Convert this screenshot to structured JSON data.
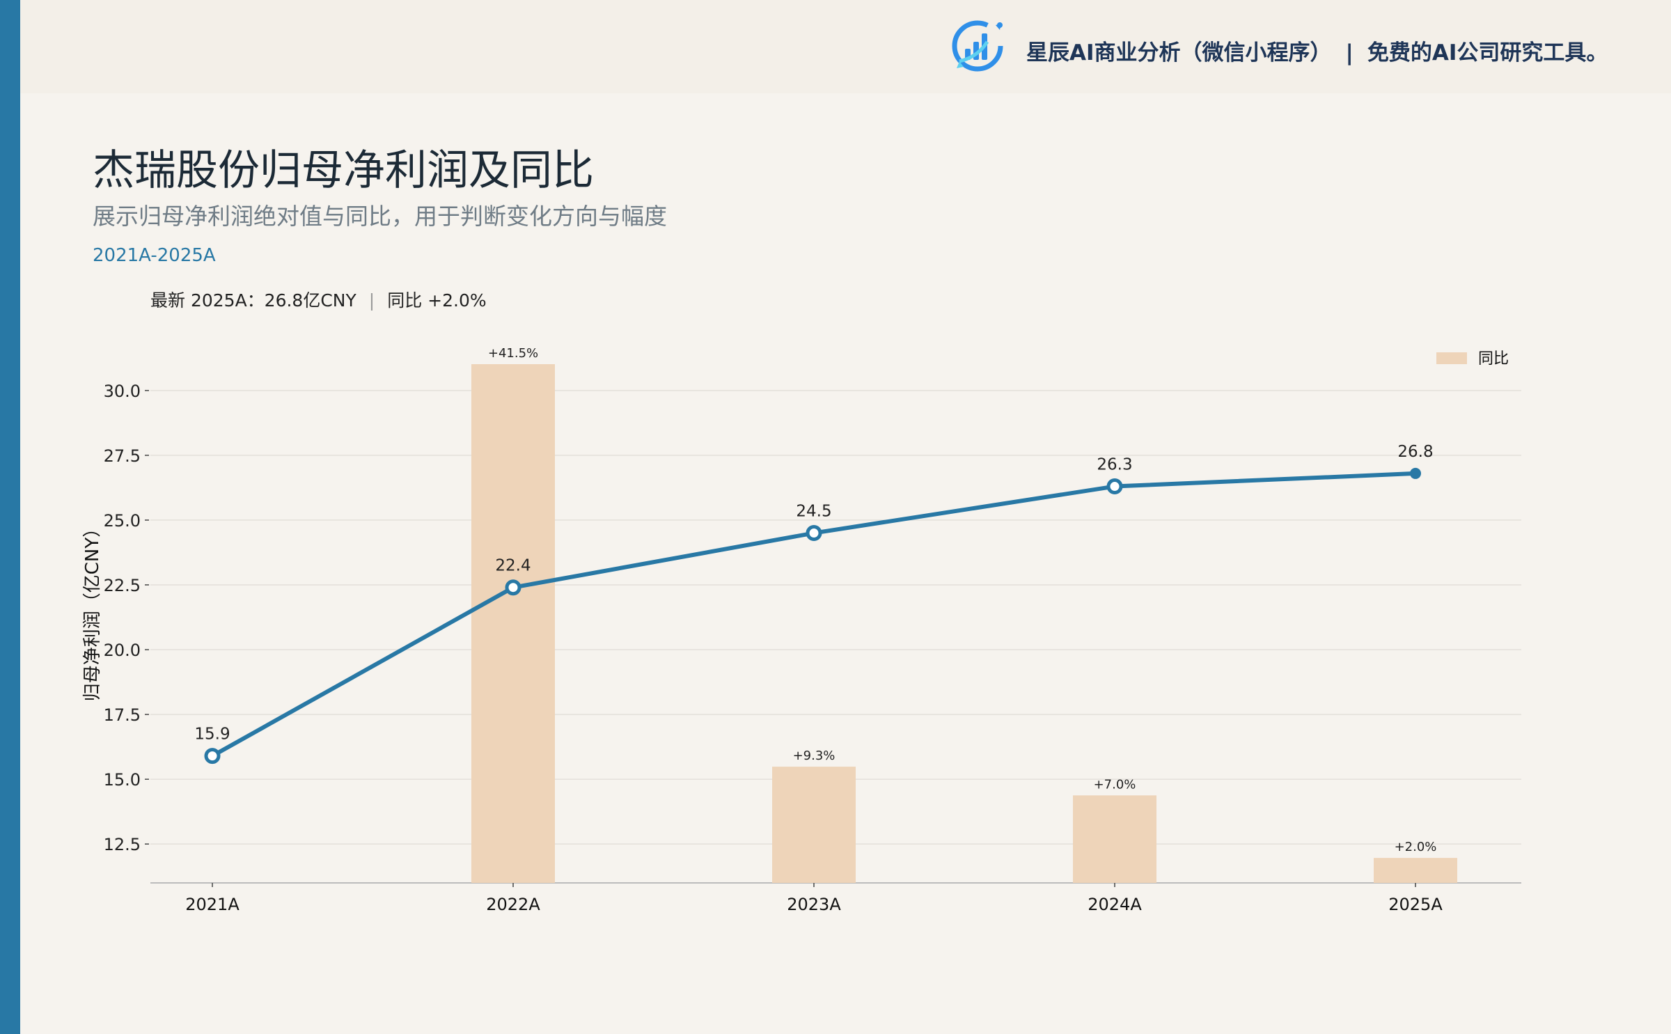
{
  "header": {
    "brand_name": "星辰AI商业分析（微信小程序）",
    "separator": "|",
    "tagline": "免费的AI公司研究工具。",
    "logo_icon": "bar-chart-refresh-icon"
  },
  "page": {
    "title": "杰瑞股份归母净利润及同比",
    "subtitle": "展示归母净利润绝对值与同比，用于判断变化方向与幅度",
    "period": "2021A-2025A",
    "latest_label": "最新 2025A：26.8亿CNY",
    "latest_sep": "|",
    "latest_yoy": "同比 +2.0%"
  },
  "colors": {
    "accent": "#2878a5",
    "bar": "#eed4b9",
    "background": "#f6f3ee"
  },
  "chart_data": {
    "type": "bar",
    "categories": [
      "2021A",
      "2022A",
      "2023A",
      "2024A",
      "2025A"
    ],
    "ylabel": "归母净利润（亿CNY）",
    "ylim": [
      11,
      31.5
    ],
    "yticks": [
      "12.5",
      "15.0",
      "17.5",
      "20.0",
      "22.5",
      "25.0",
      "27.5",
      "30.0"
    ],
    "legend": {
      "label": "同比",
      "position": "top-right"
    },
    "series": [
      {
        "type": "line",
        "values": [
          15.9,
          22.4,
          24.5,
          26.3,
          26.8
        ],
        "labels": [
          "15.9",
          "22.4",
          "24.5",
          "26.3",
          "26.8"
        ],
        "color": "#2878a5"
      },
      {
        "name": "同比",
        "type": "bar",
        "values": [
          null,
          41.5,
          9.3,
          7.0,
          2.0
        ],
        "labels": [
          "",
          "+41.5%",
          "+9.3%",
          "+7.0%",
          "+2.0%"
        ],
        "color": "#eed4b9"
      }
    ]
  }
}
